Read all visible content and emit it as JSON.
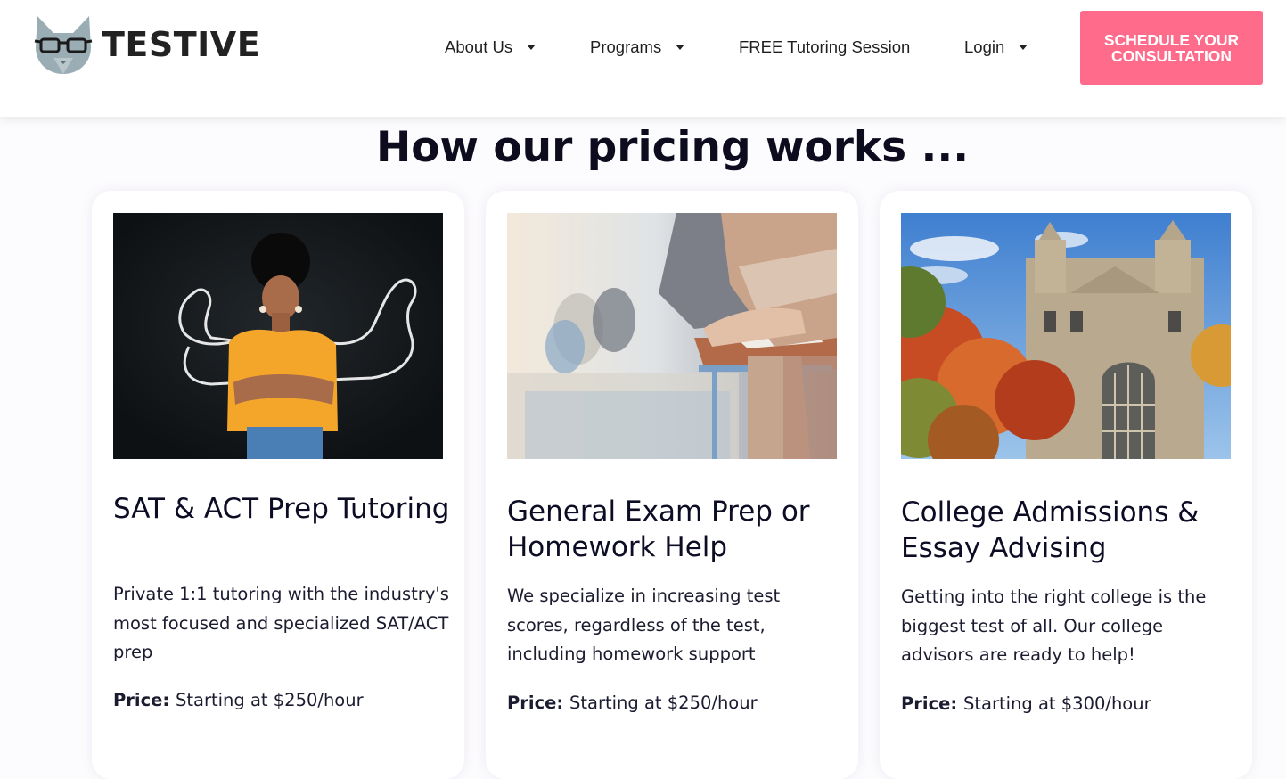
{
  "brand": {
    "name": "TESTIVE",
    "logo_icon": "cat-with-glasses-icon"
  },
  "nav": {
    "items": [
      {
        "label": "About Us",
        "has_dropdown": true
      },
      {
        "label": "Programs",
        "has_dropdown": true
      },
      {
        "label": "FREE Tutoring Session",
        "has_dropdown": false
      },
      {
        "label": "Login",
        "has_dropdown": true
      }
    ],
    "cta_label": "SCHEDULE YOUR CONSULTATION"
  },
  "colors": {
    "cta": "#ff6b8b",
    "heading": "#0c0c1e",
    "page_bg": "#fcfbfd"
  },
  "main": {
    "title": "How our pricing works ...",
    "cards": [
      {
        "image": "student-with-chalk-muscles-photo",
        "title": "SAT & ACT Prep Tutoring",
        "description": "Private 1:1 tutoring with the industry's most focused and specialized SAT/ACT prep",
        "price_label": "Price:",
        "price_value": "Starting at $250/hour"
      },
      {
        "image": "students-taking-exam-photo",
        "title": "General Exam Prep or Homework Help",
        "description": "We specialize in increasing test scores, regardless of the test, including homework support",
        "price_label": "Price:",
        "price_value": "Starting at $250/hour"
      },
      {
        "image": "college-building-autumn-photo",
        "title": "College Admissions & Essay Advising",
        "description": "Getting into the right college is the biggest test of all. Our college advisors are ready to help!",
        "price_label": "Price:",
        "price_value": "Starting at $300/hour"
      }
    ]
  }
}
